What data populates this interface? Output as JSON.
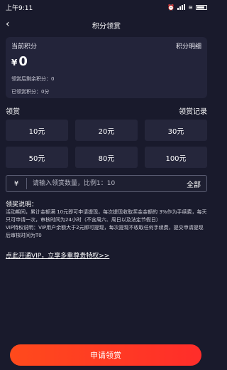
{
  "status": {
    "time": "上午9:11",
    "battery": ""
  },
  "nav": {
    "title": "积分领赏",
    "back_icon": "chevron-left-icon"
  },
  "points": {
    "current_label": "当前积分",
    "detail_link": "积分明细",
    "currency": "¥",
    "value": "0",
    "remaining": "领赏后剩余积分：0",
    "claimed": "已领赏积分：0分"
  },
  "claim": {
    "title": "领赏",
    "records_link": "领赏记录",
    "options": [
      "10元",
      "20元",
      "30元",
      "50元",
      "80元",
      "100元"
    ]
  },
  "input": {
    "currency": "¥",
    "placeholder": "请输入领赏数量，比例1：10",
    "all_label": "全部"
  },
  "rules": {
    "title": "领奖说明：",
    "text": "活动期间，累计金额满 10元即可申请提现，每次提现收取奖金金额的 3%作为手续费，每天只可申请一次，审核时间为24小时（不含周六、周日以及法定节假日）\nVIP特权说明：VIP用户余额大于2元即可提现，每次提现不收取任何手续费，提交申请提现后审核时间为T0",
    "vip_link": "点此开通VIP，立享多重尊贵特权>>"
  },
  "submit": {
    "label": "申请领赏"
  },
  "colors": {
    "background": "#191a2c",
    "card": "#23243a",
    "button_gradient_start": "#ff4a1c",
    "button_gradient_end": "#ff2d2a"
  }
}
